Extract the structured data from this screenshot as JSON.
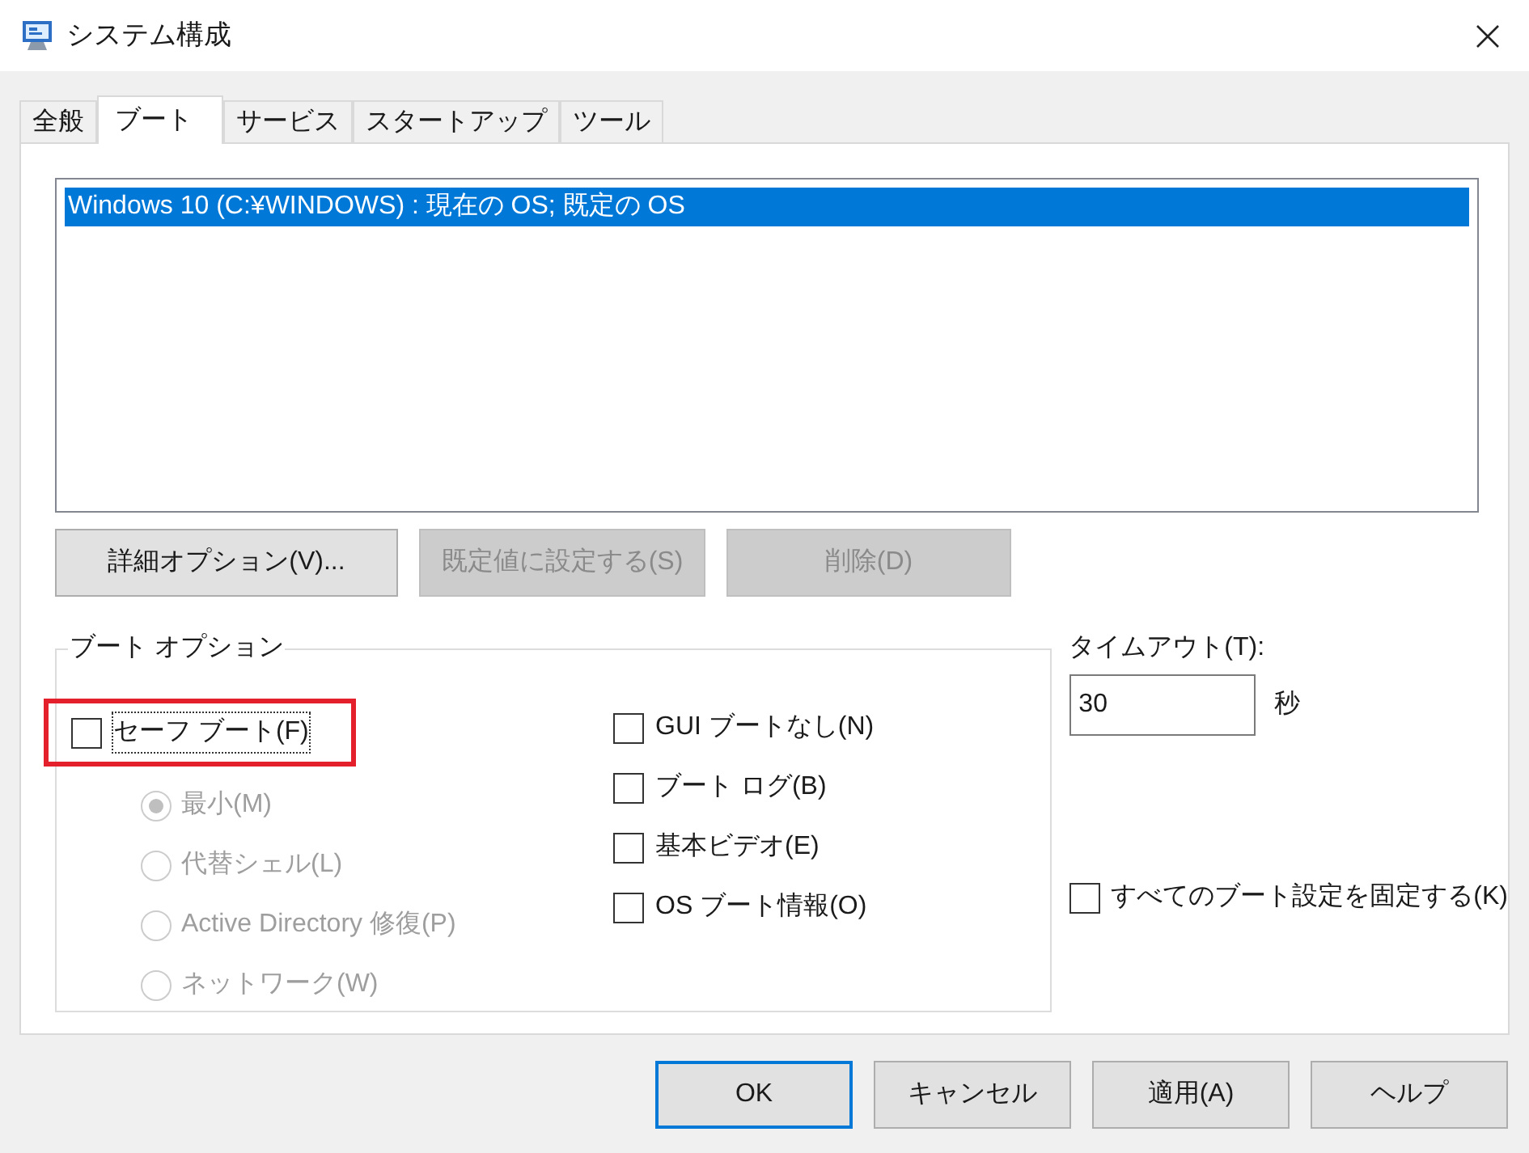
{
  "window": {
    "title": "システム構成"
  },
  "tabs": [
    {
      "label": "全般",
      "selected": false
    },
    {
      "label": "ブート",
      "selected": true
    },
    {
      "label": "サービス",
      "selected": false
    },
    {
      "label": "スタートアップ",
      "selected": false
    },
    {
      "label": "ツール",
      "selected": false
    }
  ],
  "boot_list": {
    "items": [
      {
        "label": "Windows 10 (C:¥WINDOWS) : 現在の OS; 既定の OS",
        "selected": true
      }
    ]
  },
  "list_buttons": [
    {
      "label": "詳細オプション(V)...",
      "disabled": false
    },
    {
      "label": "既定値に設定する(S)",
      "disabled": true
    },
    {
      "label": "削除(D)",
      "disabled": true
    }
  ],
  "boot_options": {
    "title": "ブート オプション",
    "safe_boot": {
      "label": "セーフ ブート(F)",
      "checked": false,
      "focused": true,
      "highlighted": true
    },
    "safe_boot_modes": [
      {
        "label": "最小(M)",
        "selected": true,
        "disabled": true
      },
      {
        "label": "代替シェル(L)",
        "selected": false,
        "disabled": true
      },
      {
        "label": "Active Directory 修復(P)",
        "selected": false,
        "disabled": true
      },
      {
        "label": "ネットワーク(W)",
        "selected": false,
        "disabled": true
      }
    ],
    "other_options": [
      {
        "label": "GUI ブートなし(N)",
        "checked": false
      },
      {
        "label": "ブート ログ(B)",
        "checked": false
      },
      {
        "label": "基本ビデオ(E)",
        "checked": false
      },
      {
        "label": "OS ブート情報(O)",
        "checked": false
      }
    ]
  },
  "timeout": {
    "label": "タイムアウト(T):",
    "value": "30",
    "unit": "秒"
  },
  "lock_settings": {
    "label": "すべてのブート設定を固定する(K)",
    "checked": false
  },
  "dialog_buttons": [
    {
      "label": "OK",
      "default": true
    },
    {
      "label": "キャンセル",
      "default": false
    },
    {
      "label": "適用(A)",
      "default": false
    },
    {
      "label": "ヘルプ",
      "default": false
    }
  ]
}
